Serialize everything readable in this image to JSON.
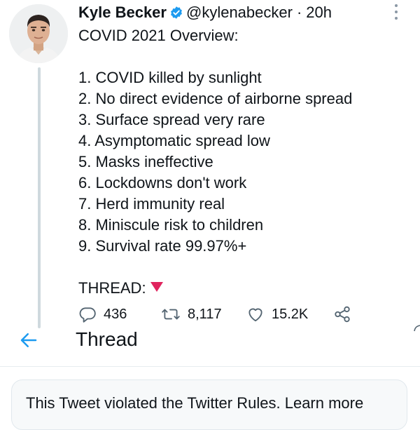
{
  "tweet": {
    "author_name": "Kyle Becker",
    "handle": "@kylenabecker",
    "separator": "·",
    "time": "20h",
    "verified": true,
    "lines": [
      "COVID 2021 Overview:",
      "",
      "1. COVID killed by sunlight",
      "2. No direct evidence of airborne spread",
      "3. Surface spread very rare",
      "4. Asymptomatic spread low",
      "5. Masks ineffective",
      "6. Lockdowns don't work",
      "7. Herd immunity real",
      "8. Miniscule risk to children",
      "9. Survival rate 99.97%+",
      ""
    ],
    "thread_label": "THREAD:",
    "thread_icon": "red-down-triangle-icon",
    "actions": {
      "replies": "436",
      "retweets": "8,117",
      "likes": "15.2K"
    }
  },
  "thread_header": {
    "title": "Thread"
  },
  "violation": {
    "text": "This Tweet violated the Twitter Rules.",
    "link": "Learn more"
  },
  "colors": {
    "accent": "#1d9bf0",
    "verified": "#1d9bf0",
    "thread_triangle": "#e0245e",
    "icon_gray": "#536471"
  }
}
